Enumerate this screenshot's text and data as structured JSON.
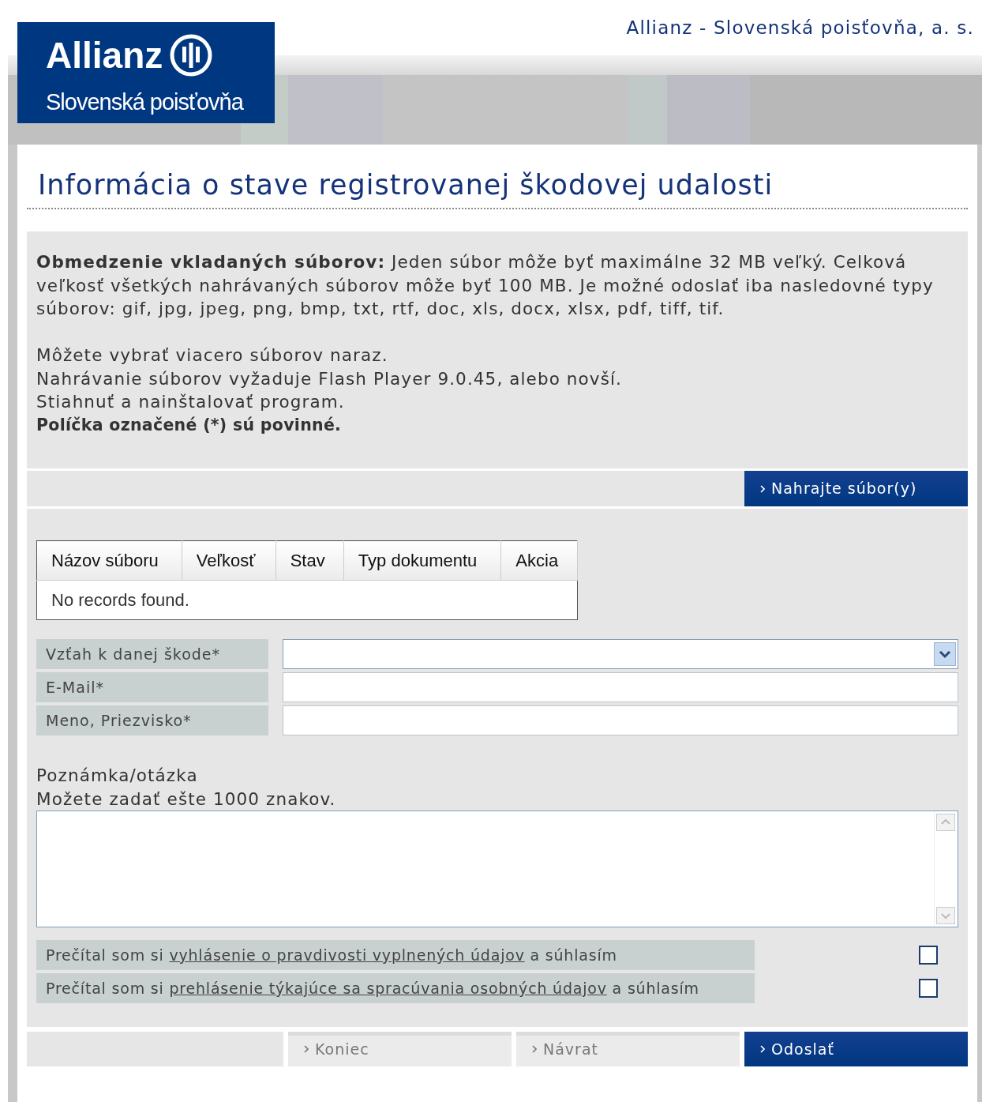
{
  "header": {
    "brand_name": "Allianz",
    "brand_sub": "Slovenská poisťovňa",
    "company": "Allianz - Slovenská poisťovňa, a. s."
  },
  "page_title": "Informácia o stave registrovanej škodovej udalosti",
  "info": {
    "restriction": "**Obmedzenie vkladaných súborov:** Jeden súbor môže byť maximálne 32 MB veľký. Celková veľkosť všetkých nahrávaných súborov môže byť 100 MB. Je možné odoslať iba nasledovné typy súborov: gif, jpg, jpeg, png, bmp, txt, rtf, doc, xls, docx, xlsx, pdf, tiff, tif.",
    "lines": [
      "Môžete vybrať viacero súborov naraz.",
      "Nahrávanie súborov vyžaduje Flash Player 9.0.45, alebo novší.",
      "Stiahnuť a nainštalovať program."
    ],
    "required_note": "Políčka označené (*) sú povinné."
  },
  "upload_button": "Nahrajte súbor(y)",
  "files_table": {
    "columns": [
      "Názov súboru",
      "Veľkosť",
      "Stav",
      "Typ dokumentu",
      "Akcia"
    ],
    "empty_message": "No records found."
  },
  "fields": [
    {
      "label": "Vzťah k danej škode*",
      "kind": "select"
    },
    {
      "label": "E-Mail*",
      "kind": "text"
    },
    {
      "label": "Meno, Priezvisko*",
      "kind": "text"
    }
  ],
  "note": {
    "label": "Poznámka/otázka",
    "hint": "Možete zadať ešte 1000 znakov."
  },
  "consents": [
    {
      "prefix": "Prečítal som si",
      "link": "vyhlásenie o pravdivosti vyplnených údajov",
      "suffix": "a súhlasím",
      "checked": false
    },
    {
      "prefix": "Prečítal som si",
      "link": "prehlásenie týkajúce sa spracúvania osobných údajov",
      "suffix": "a súhlasím",
      "checked": false
    }
  ],
  "buttons": [
    {
      "label": "Koniec",
      "kind": "secondary"
    },
    {
      "label": "Návrat",
      "kind": "secondary"
    },
    {
      "label": "Odoslať",
      "kind": "primary"
    }
  ]
}
